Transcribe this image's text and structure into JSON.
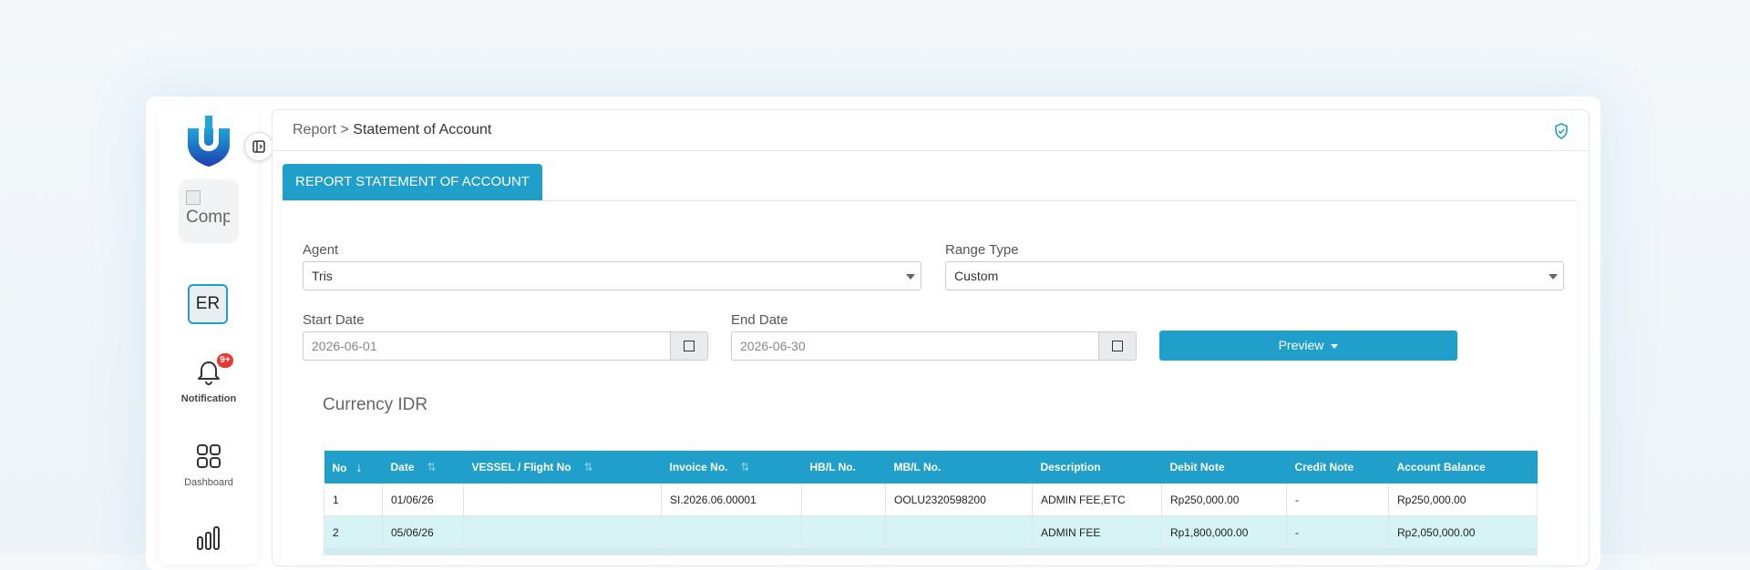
{
  "sidebar": {
    "company_alt": "Comp",
    "avatar_initials": "ER",
    "notification_badge": "9+",
    "items": [
      {
        "label": "Notification",
        "icon": "bell-icon"
      },
      {
        "label": "Dashboard",
        "icon": "grid-icon"
      },
      {
        "label": "",
        "icon": "bar-chart-icon"
      }
    ]
  },
  "header": {
    "breadcrumb_root": "Report",
    "breadcrumb_separator": ">",
    "breadcrumb_current": "Statement of Account"
  },
  "tab": {
    "label": "REPORT STATEMENT OF ACCOUNT"
  },
  "form": {
    "agent_label": "Agent",
    "agent_value": "Tris",
    "range_type_label": "Range Type",
    "range_type_value": "Custom",
    "start_date_label": "Start Date",
    "start_date_value": "2026-06-01",
    "end_date_label": "End Date",
    "end_date_value": "2026-06-30",
    "preview_label": "Preview"
  },
  "currency_title": "Currency IDR",
  "table": {
    "columns": [
      "No",
      "Date",
      "VESSEL / Flight No",
      "Invoice No.",
      "HB/L No.",
      "MB/L No.",
      "Description",
      "Debit Note",
      "Credit Note",
      "Account Balance"
    ],
    "rows": [
      [
        "1",
        "01/06/26",
        "",
        "SI.2026.06.00001",
        "",
        "OOLU2320598200",
        "ADMIN FEE,ETC",
        "Rp250,000.00",
        "-",
        "Rp250,000.00"
      ],
      [
        "2",
        "05/06/26",
        "",
        "",
        "",
        "",
        "ADMIN FEE",
        "Rp1,800,000.00",
        "-",
        "Rp2,050,000.00"
      ]
    ]
  },
  "colors": {
    "accent": "#1f9fc9",
    "row_alt": "#d6f3f6",
    "badge": "#e53935"
  }
}
